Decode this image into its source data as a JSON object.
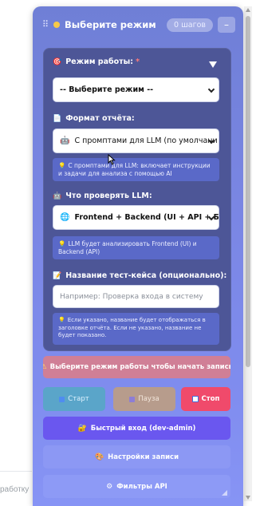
{
  "background": {
    "partial_text": "работку"
  },
  "header": {
    "drag_icon": "drag-handle-icon",
    "title": "Выберите режим",
    "steps_badge": "0 шагов",
    "collapse_label": "–"
  },
  "form": {
    "mode": {
      "label": "Режим работы:",
      "required_mark": "*",
      "selected": "-- Выберите режим --"
    },
    "report_format": {
      "label": "Формат отчёта:",
      "selected": "С промптами для LLM (по умолчани",
      "hint": "С промптами для LLM: включает инструкции и задачи для анализа с помощью AI"
    },
    "llm_check": {
      "label": "Что проверять LLM:",
      "selected": "Frontend + Backend (UI + API + БД)",
      "hint": "LLM будет анализировать Frontend (UI) и Backend (API)"
    },
    "test_name": {
      "label": "Название тест-кейса (опционально):",
      "placeholder": "Например: Проверка входа в систему",
      "hint": "Если указано, название будет отображаться в заголовке отчёта. Если не указано, название не будет показано."
    }
  },
  "warning": "Выберите режим работы чтобы начать запись",
  "controls": {
    "start": "Старт",
    "pause": "Пауза",
    "stop": "Стоп"
  },
  "buttons": {
    "quick_login": "Быстрый вход (dev-admin)",
    "record_settings": "Настройки записи",
    "api_filters": "Фильтры API"
  },
  "colors": {
    "panel_top": "#6f7fd6",
    "form_card": "#4d5697",
    "hint_bg": "#5a69c8",
    "warning_bg": "#d07f96",
    "stop": "#f04a6b",
    "quick_login": "#6a57ef"
  }
}
